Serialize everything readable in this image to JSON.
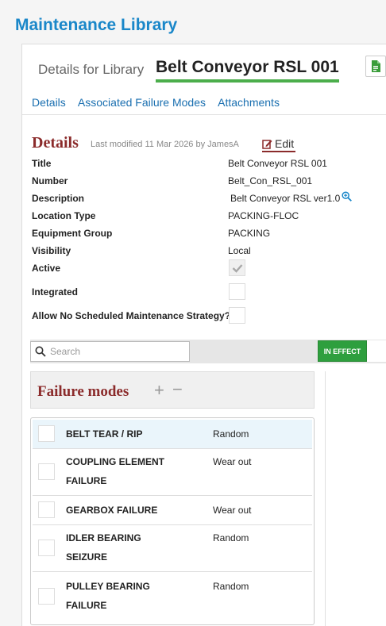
{
  "app": {
    "title": "Maintenance Library"
  },
  "header": {
    "prefix": "Details for Library",
    "name": "Belt Conveyor RSL 001"
  },
  "tabs": [
    {
      "label": "Details"
    },
    {
      "label": "Associated Failure Modes"
    },
    {
      "label": "Attachments"
    }
  ],
  "details": {
    "title": "Details",
    "modified": "Last modified 11 Mar 2026 by JamesA",
    "edit_label": "Edit",
    "fields": {
      "title": {
        "label": "Title",
        "value": "Belt Conveyor RSL 001"
      },
      "number": {
        "label": "Number",
        "value": "Belt_Con_RSL_001"
      },
      "description": {
        "label": "Description",
        "value": "Belt Conveyor RSL ver1.0"
      },
      "location_type": {
        "label": "Location Type",
        "value": "PACKING-FLOC"
      },
      "equipment": {
        "label": "Equipment Group",
        "value": "PACKING"
      },
      "visibility": {
        "label": "Visibility",
        "value": "Local"
      },
      "active": {
        "label": "Active",
        "checked": true
      },
      "integrated": {
        "label": "Integrated",
        "checked": false
      },
      "allow_no_sched": {
        "label": "Allow No Scheduled Maintenance Strategy?",
        "checked": false
      }
    }
  },
  "search": {
    "placeholder": "Search",
    "value": ""
  },
  "status": {
    "label": "IN EFFECT",
    "color": "#2e9f3e"
  },
  "failure_modes": {
    "title": "Failure modes",
    "add": "+",
    "remove": "−",
    "items": [
      {
        "name": "BELT TEAR / RIP",
        "type": "Random"
      },
      {
        "name": "COUPLING ELEMENT FAILURE",
        "type": "Wear out"
      },
      {
        "name": "GEARBOX FAILURE",
        "type": "Wear out"
      },
      {
        "name": "IDLER BEARING SEIZURE",
        "type": "Random"
      },
      {
        "name": "PULLEY BEARING FAILURE",
        "type": "Random"
      }
    ]
  },
  "colors": {
    "accent": "#1a87c9",
    "section": "#8b2b2b",
    "underline": "#4cae4c"
  }
}
